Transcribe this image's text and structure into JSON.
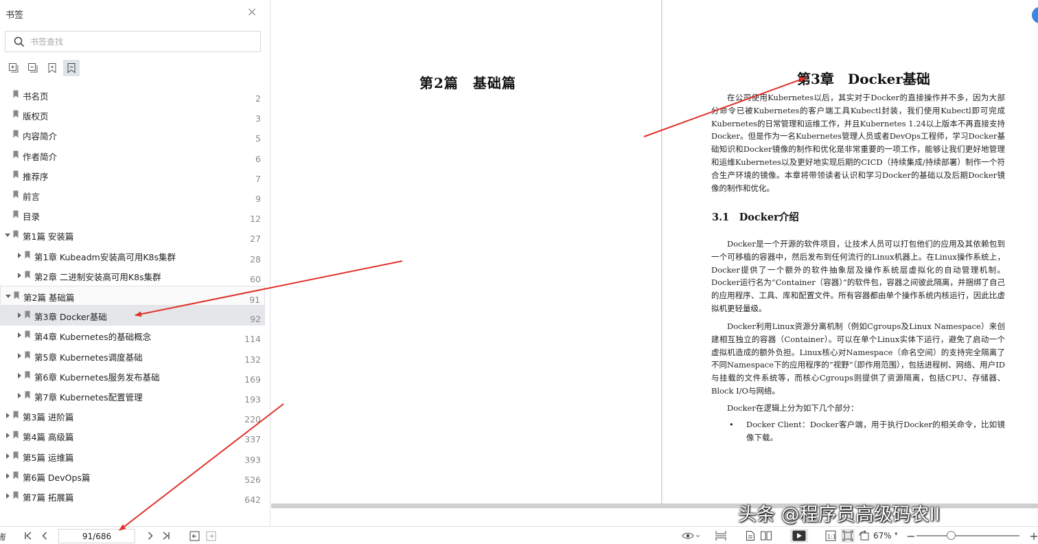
{
  "sidebar": {
    "title": "书签",
    "search_placeholder": "书签查找",
    "tools": [
      "expand-all-icon",
      "collapse-all-icon",
      "add-bookmark-icon",
      "bookmark-view-icon"
    ],
    "items": [
      {
        "label": "书名页",
        "page": "2",
        "level": 0,
        "expander": "none"
      },
      {
        "label": "版权页",
        "page": "3",
        "level": 0,
        "expander": "none"
      },
      {
        "label": "内容简介",
        "page": "5",
        "level": 0,
        "expander": "none"
      },
      {
        "label": "作者简介",
        "page": "6",
        "level": 0,
        "expander": "none"
      },
      {
        "label": "推荐序",
        "page": "7",
        "level": 0,
        "expander": "none"
      },
      {
        "label": "前言",
        "page": "9",
        "level": 0,
        "expander": "none"
      },
      {
        "label": "目录",
        "page": "12",
        "level": 0,
        "expander": "none"
      },
      {
        "label": "第1篇 安装篇",
        "page": "27",
        "level": 0,
        "expander": "expanded"
      },
      {
        "label": "第1章 Kubeadm安装高可用K8s集群",
        "page": "28",
        "level": 1,
        "expander": "collapsed"
      },
      {
        "label": "第2章 二进制安装高可用K8s集群",
        "page": "60",
        "level": 1,
        "expander": "collapsed"
      },
      {
        "label": "第2篇 基础篇",
        "page": "91",
        "level": 0,
        "expander": "expanded"
      },
      {
        "label": "第3章 Docker基础",
        "page": "92",
        "level": 1,
        "expander": "collapsed"
      },
      {
        "label": "第4章 Kubernetes的基础概念",
        "page": "114",
        "level": 1,
        "expander": "collapsed"
      },
      {
        "label": "第5章 Kubernetes调度基础",
        "page": "132",
        "level": 1,
        "expander": "collapsed"
      },
      {
        "label": "第6章 Kubernetes服务发布基础",
        "page": "169",
        "level": 1,
        "expander": "collapsed"
      },
      {
        "label": "第7章 Kubernetes配置管理",
        "page": "193",
        "level": 1,
        "expander": "collapsed"
      },
      {
        "label": "第3篇 进阶篇",
        "page": "220",
        "level": 0,
        "expander": "collapsed"
      },
      {
        "label": "第4篇 高级篇",
        "page": "337",
        "level": 0,
        "expander": "collapsed"
      },
      {
        "label": "第5篇 运维篇",
        "page": "393",
        "level": 0,
        "expander": "collapsed"
      },
      {
        "label": "第6篇 DevOps篇",
        "page": "526",
        "level": 0,
        "expander": "collapsed"
      },
      {
        "label": "第7篇 拓展篇",
        "page": "642",
        "level": 0,
        "expander": "collapsed"
      }
    ],
    "selected_index": 11,
    "framed_index": 10
  },
  "document": {
    "left_page_title": "第2篇　基础篇",
    "chapter_title": "第3章　Docker基础",
    "intro_paragraph": "在公司使用Kubernetes以后，其实对于Docker的直接操作并不多，因为大部分命令已被Kubernetes的客户端工具Kubectl封装，我们使用Kubectl即可完成Kubernetes的日常管理和运维工作，并且Kubernetes 1.24以上版本不再直接支持Docker。但是作为一名Kubernetes管理人员或者DevOps工程师，学习Docker基础知识和Docker镜像的制作和优化是非常重要的一项工作，能够让我们更好地管理和运维Kubernetes以及更好地实现后期的CICD（持续集成/持续部署）制作一个符合生产环境的镜像。本章将带领读者认识和学习Docker的基础以及后期Docker镜像的制作和优化。",
    "section_title": "3.1　Docker介绍",
    "para1": "Docker是一个开源的软件项目，让技术人员可以打包他们的应用及其依赖包到一个可移植的容器中，然后发布到任何流行的Linux机器上。在Linux操作系统上，Docker提供了一个额外的软件抽象层及操作系统层虚拟化的自动管理机制。Docker运行名为“Container（容器）”的软件包，容器之间彼此隔离，并捆绑了自己的应用程序、工具、库和配置文件。所有容器都由单个操作系统内核运行，因此比虚拟机更轻量级。",
    "para2": "Docker利用Linux资源分离机制（例如Cgroups及Linux Namespace）来创建相互独立的容器（Container）。可以在单个Linux实体下运行，避免了启动一个虚拟机造成的额外负担。Linux核心对Namespace（命名空间）的支持完全隔离了不同Namespace下的应用程序的“视野”（即作用范围），包括进程树、网络、用户ID与挂载的文件系统等，而核心Cgroups则提供了资源隔离，包括CPU、存储器、Block I/O与网络。",
    "para3": "Docker在逻辑上分为如下几个部分：",
    "bullet_symbol": "•",
    "bullet1": "Docker Client：Docker客户端，用于执行Docker的相关命令，比如镜像下载。"
  },
  "statusbar": {
    "left_edge_text": "航",
    "page_indicator": "91/686",
    "zoom": "67%",
    "zoom_fraction": 0.33
  },
  "watermark": "头条 @程序员高级码农II",
  "colors": {
    "arrow": "#e0302a",
    "selection": "#e4e6ea",
    "accent": "#3a86e0"
  }
}
